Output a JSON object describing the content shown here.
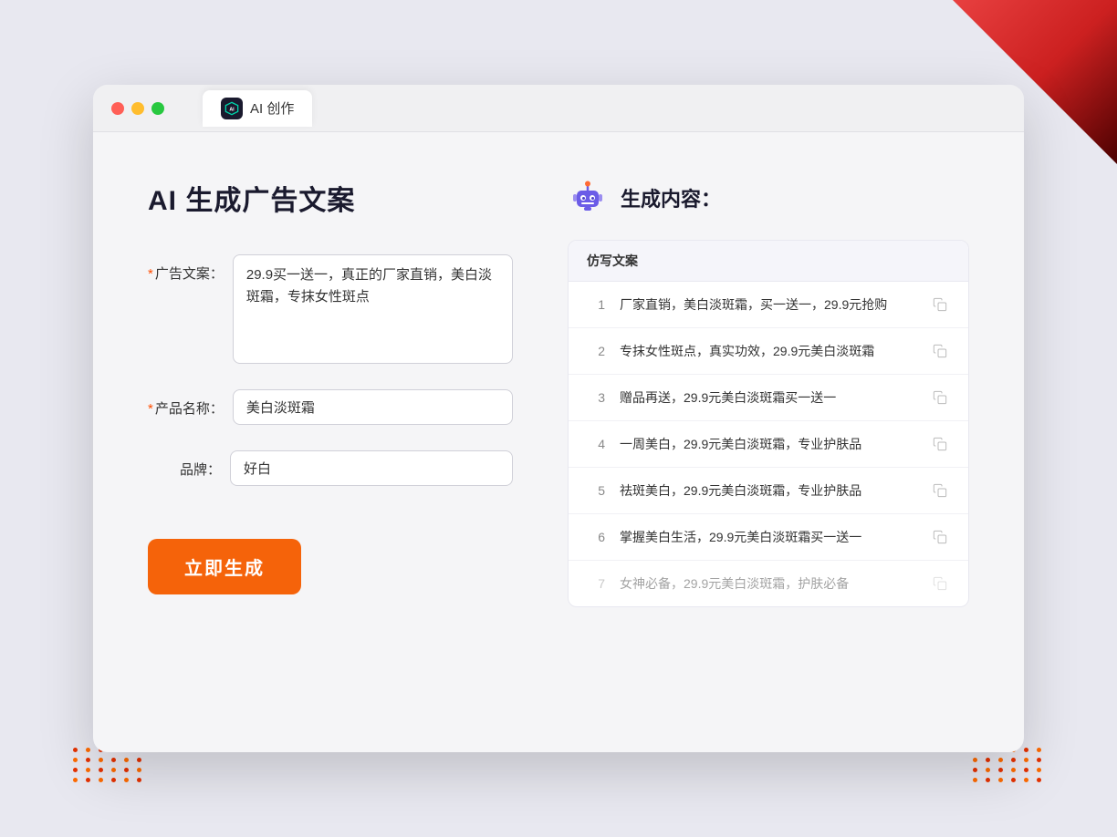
{
  "background": {
    "color": "#e8e8f0"
  },
  "browser": {
    "tab_title": "AI 创作",
    "traffic_lights": [
      "red",
      "yellow",
      "green"
    ]
  },
  "page": {
    "title": "AI 生成广告文案"
  },
  "form": {
    "ad_copy_label": "广告文案：",
    "ad_copy_required": "*",
    "ad_copy_value": "29.9买一送一，真正的厂家直销，美白淡斑霜，专抹女性斑点",
    "product_name_label": "产品名称：",
    "product_name_required": "*",
    "product_name_value": "美白淡斑霜",
    "brand_label": "品牌：",
    "brand_value": "好白",
    "generate_button": "立即生成"
  },
  "result": {
    "header_title": "生成内容：",
    "table_header": "仿写文案",
    "items": [
      {
        "num": "1",
        "text": "厂家直销，美白淡斑霜，买一送一，29.9元抢购",
        "dimmed": false
      },
      {
        "num": "2",
        "text": "专抹女性斑点，真实功效，29.9元美白淡斑霜",
        "dimmed": false
      },
      {
        "num": "3",
        "text": "赠品再送，29.9元美白淡斑霜买一送一",
        "dimmed": false
      },
      {
        "num": "4",
        "text": "一周美白，29.9元美白淡斑霜，专业护肤品",
        "dimmed": false
      },
      {
        "num": "5",
        "text": "祛斑美白，29.9元美白淡斑霜，专业护肤品",
        "dimmed": false
      },
      {
        "num": "6",
        "text": "掌握美白生活，29.9元美白淡斑霜买一送一",
        "dimmed": false
      },
      {
        "num": "7",
        "text": "女神必备，29.9元美白淡斑霜，护肤必备",
        "dimmed": true
      }
    ]
  }
}
